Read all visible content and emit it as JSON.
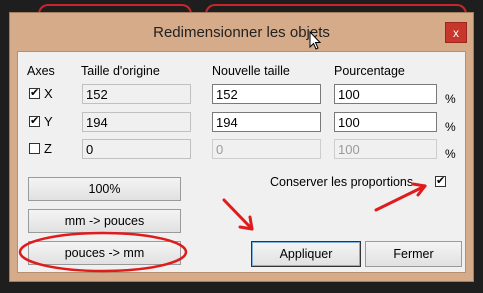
{
  "window": {
    "title": "Redimensionner les objets",
    "close_glyph": "x"
  },
  "headers": {
    "axes": "Axes",
    "original": "Taille d'origine",
    "new_size": "Nouvelle taille",
    "percent": "Pourcentage"
  },
  "rows": [
    {
      "axis": "X",
      "checked": true,
      "original": "152",
      "new_size": "152",
      "percent": "100",
      "unit": "%"
    },
    {
      "axis": "Y",
      "checked": true,
      "original": "194",
      "new_size": "194",
      "percent": "100",
      "unit": "%"
    },
    {
      "axis": "Z",
      "checked": false,
      "original": "0",
      "new_size": "0",
      "percent": "100",
      "unit": "%"
    }
  ],
  "buttons": {
    "hundred": "100%",
    "mm_to_inch": "mm -> pouces",
    "inch_to_mm": "pouces -> mm",
    "apply": "Appliquer",
    "close": "Fermer"
  },
  "keep_proportions": {
    "label": "Conserver les proportions",
    "checked": true
  },
  "colors": {
    "title_bar": "#d5ab89",
    "close_button": "#c7372b",
    "annotation": "#e01b1b",
    "client": "#f0f0f0"
  }
}
